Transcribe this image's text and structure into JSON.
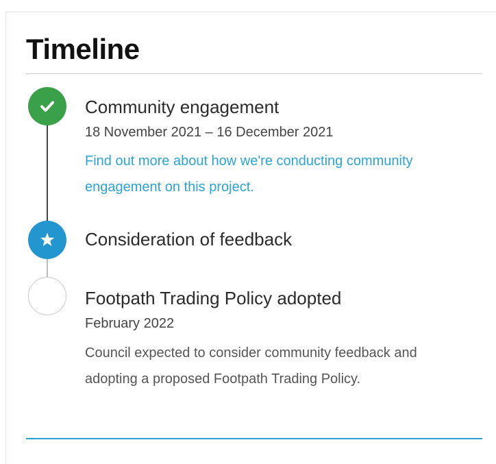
{
  "timeline": {
    "title": "Timeline",
    "steps": [
      {
        "status": "completed",
        "icon": "check-icon",
        "title": "Community engagement",
        "date": "18 November 2021 – 16 December 2021",
        "link_text": "Find out more about how we're conducting community engagement on this project."
      },
      {
        "status": "current",
        "icon": "star-icon",
        "title": "Consideration of feedback"
      },
      {
        "status": "upcoming",
        "icon": "empty-circle-icon",
        "title": "Footpath Trading Policy adopted",
        "date": "February 2022",
        "description": "Council expected to consider community feedback and adopting a proposed Footpath Trading Policy."
      }
    ]
  },
  "colors": {
    "completed": "#3aa04a",
    "current": "#2496cf",
    "link": "#2ba3d6",
    "accent_rule": "#2ba3d6"
  }
}
